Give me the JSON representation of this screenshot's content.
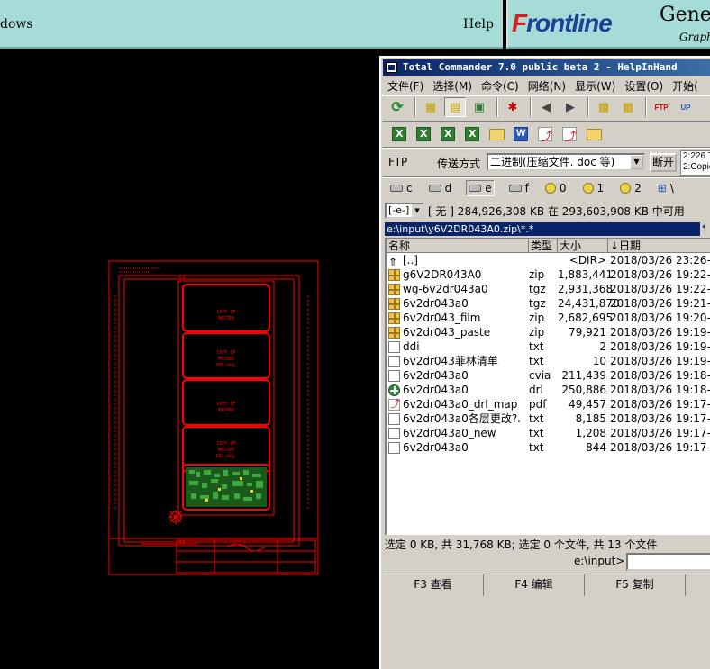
{
  "genesis": {
    "left_text": "dows",
    "help": "Help",
    "logo_front": "F",
    "logo_rest": "rontline",
    "product": "Genes",
    "subtitle": "Graph"
  },
  "pcb": {
    "panel_labels": [
      {
        "line1": "COPY OF",
        "line2": "MASTER",
        "line3": ""
      },
      {
        "line1": "COPY OF",
        "line2": "MASTER",
        "line3": "180 deg."
      },
      {
        "line1": "COPY OF",
        "line2": "MASTER",
        "line3": ""
      },
      {
        "line1": "COPY OF",
        "line2": "MASTER",
        "line3": "180 deg."
      }
    ]
  },
  "tc": {
    "title": "Total Commander 7.0 public beta 2 - HelpInHand",
    "menu": [
      "文件(F)",
      "选择(M)",
      "命令(C)",
      "网络(N)",
      "显示(W)",
      "设置(O)",
      "开始("
    ],
    "ftp": {
      "label": "FTP",
      "transfer_label": "传送方式",
      "mode_value": "二进制(压缩文件. doc 等)",
      "disconnect_label": "断开",
      "log_line1": "2:226 T",
      "log_line2": "2:Copie"
    },
    "drives": [
      {
        "letter": "c",
        "type": "hdd"
      },
      {
        "letter": "d",
        "type": "hdd"
      },
      {
        "letter": "e",
        "type": "hdd",
        "selected": true
      },
      {
        "letter": "f",
        "type": "hdd"
      },
      {
        "letter": "0",
        "type": "cd"
      },
      {
        "letter": "1",
        "type": "cd"
      },
      {
        "letter": "2",
        "type": "cd"
      },
      {
        "letter": "\\",
        "type": "net"
      }
    ],
    "panel": {
      "drive_select": "[-e-]",
      "free_space": "[ 无 ]  284,926,308 KB 在 293,603,908 KB 中可用",
      "path": "e:\\input\\y6V2DR043A0.zip\\*.*",
      "path_right": "*"
    },
    "columns": {
      "name": "名称",
      "ext": "类型",
      "size": "大小",
      "date": "↓日期"
    },
    "files": [
      {
        "icon": "up",
        "name": "[..]",
        "ext": "",
        "size": "<DIR>",
        "date": "2018/03/26 23:26—"
      },
      {
        "icon": "arc",
        "name": "g6V2DR043A0",
        "ext": "zip",
        "size": "1,883,441",
        "date": "2018/03/26 19:22-a"
      },
      {
        "icon": "arc",
        "name": "wg-6v2dr043a0",
        "ext": "tgz",
        "size": "2,931,368",
        "date": "2018/03/26 19:22-a"
      },
      {
        "icon": "arc",
        "name": "6v2dr043a0",
        "ext": "tgz",
        "size": "24,431,870",
        "date": "2018/03/26 19:21-a"
      },
      {
        "icon": "arc",
        "name": "6v2dr043_film",
        "ext": "zip",
        "size": "2,682,695",
        "date": "2018/03/26 19:20-a"
      },
      {
        "icon": "arc",
        "name": "6v2dr043_paste",
        "ext": "zip",
        "size": "79,921",
        "date": "2018/03/26 19:19-a"
      },
      {
        "icon": "doc",
        "name": "ddi",
        "ext": "txt",
        "size": "2",
        "date": "2018/03/26 19:19-a"
      },
      {
        "icon": "doc",
        "name": "6v2dr043菲林清单",
        "ext": "txt",
        "size": "10",
        "date": "2018/03/26 19:19-a"
      },
      {
        "icon": "doc",
        "name": "6v2dr043a0",
        "ext": "cvia",
        "size": "211,439",
        "date": "2018/03/26 19:18-a"
      },
      {
        "icon": "drl",
        "name": "6v2dr043a0",
        "ext": "drl",
        "size": "250,886",
        "date": "2018/03/26 19:18-a"
      },
      {
        "icon": "pdf",
        "name": "6v2dr043a0_drl_map",
        "ext": "pdf",
        "size": "49,457",
        "date": "2018/03/26 19:17-a"
      },
      {
        "icon": "doc",
        "name": "6v2dr043a0各层更改?.",
        "ext": "txt",
        "size": "8,185",
        "date": "2018/03/26 19:17-a"
      },
      {
        "icon": "doc",
        "name": "6v2dr043a0_new",
        "ext": "txt",
        "size": "1,208",
        "date": "2018/03/26 19:17-a"
      },
      {
        "icon": "doc",
        "name": "6v2dr043a0",
        "ext": "txt",
        "size": "844",
        "date": "2018/03/26 19:17-a"
      }
    ],
    "status": "选定 0 KB, 共 31,768 KB; 选定 0 个文件, 共 13 个文件",
    "cmd_prompt": "e:\\input>",
    "fkeys": [
      "F3 查看",
      "F4 编辑",
      "F5 复制"
    ],
    "colors": {
      "title_start": "#0a246a",
      "title_end": "#3a6ea5",
      "window": "#d4d0c8"
    }
  },
  "colors": {
    "pcb": "#ff0000",
    "pcb_green": "#3fa83f",
    "genesis_bar": "#a6dcd8"
  }
}
